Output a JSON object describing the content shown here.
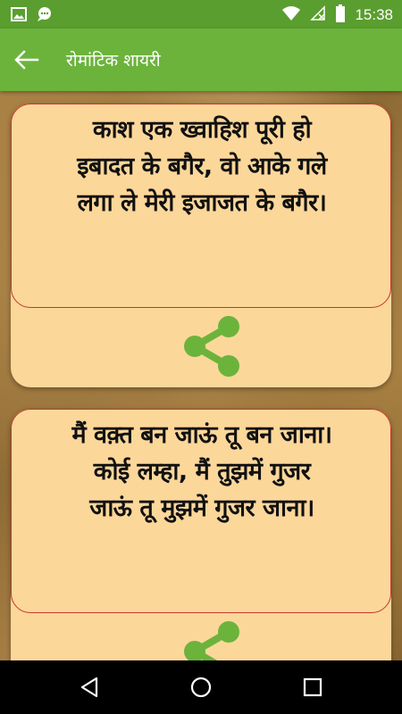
{
  "status_bar": {
    "time": "15:38",
    "icons": [
      "image-icon",
      "message-icon",
      "wifi-icon",
      "no-signal-icon",
      "battery-icon"
    ]
  },
  "app_bar": {
    "title": "रोमांटिक शायरी",
    "back_icon": "arrow-left-icon"
  },
  "colors": {
    "status_bar": "#5a9e2f",
    "app_bar": "#6cb33c",
    "card": "#fcd79a",
    "card_border": "#c0392b",
    "share_icon": "#6cb33c"
  },
  "quotes": [
    {
      "text": "काश एक ख्वाहिश पूरी हो\nइबादत के बगैर, वो आके गले\nलगा ले मेरी इजाजत के बगैर।",
      "share_icon": "share-icon"
    },
    {
      "text": "मैं वक़्त बन जाऊं तू बन जाना।\nकोई लम्हा, मैं तुझमें गुजर\nजाऊं तू मुझमें गुजर जाना।",
      "share_icon": "share-icon"
    }
  ],
  "nav_bar": {
    "icons": [
      "back-triangle-icon",
      "home-circle-icon",
      "recents-square-icon"
    ]
  }
}
